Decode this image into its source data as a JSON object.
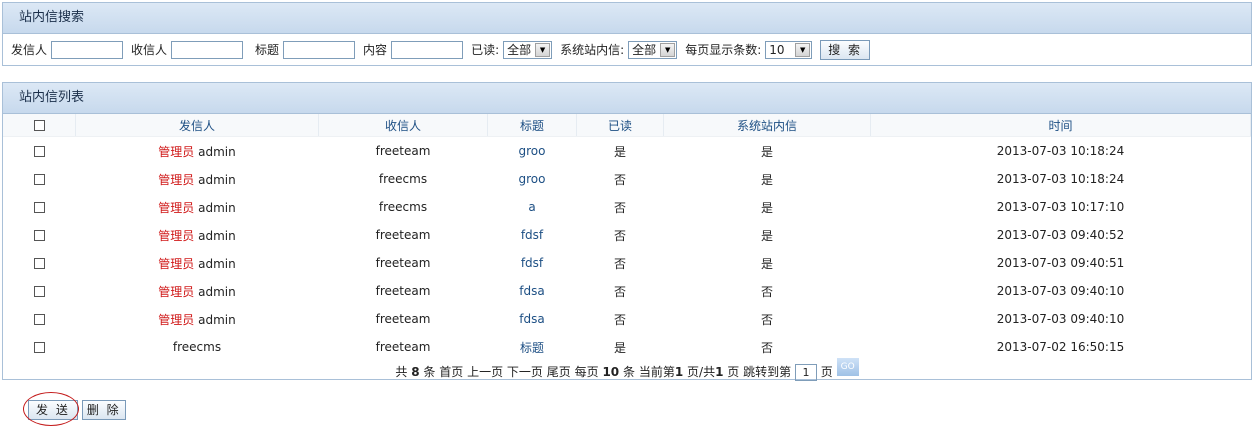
{
  "search": {
    "panel_title": "站内信搜索",
    "sender_label": "发信人",
    "sender_value": "",
    "receiver_label": "收信人",
    "receiver_value": "",
    "title_label": "标题",
    "title_value": "",
    "content_label": "内容",
    "content_value": "",
    "read_label": "已读:",
    "read_selected": "全部",
    "system_label": "系统站内信:",
    "system_selected": "全部",
    "page_size_label": "每页显示条数:",
    "page_size_selected": "10",
    "search_button": "搜 索"
  },
  "list": {
    "panel_title": "站内信列表",
    "columns": [
      "发信人",
      "收信人",
      "标题",
      "已读",
      "系统站内信",
      "时间"
    ],
    "rows": [
      {
        "sender_tag": "管理员",
        "sender": "admin",
        "receiver": "freeteam",
        "title": "groo",
        "read": "是",
        "system": "是",
        "time": "2013-07-03 10:18:24"
      },
      {
        "sender_tag": "管理员",
        "sender": "admin",
        "receiver": "freecms",
        "title": "groo",
        "read": "否",
        "system": "是",
        "time": "2013-07-03 10:18:24"
      },
      {
        "sender_tag": "管理员",
        "sender": "admin",
        "receiver": "freecms",
        "title": "a",
        "read": "否",
        "system": "是",
        "time": "2013-07-03 10:17:10"
      },
      {
        "sender_tag": "管理员",
        "sender": "admin",
        "receiver": "freeteam",
        "title": "fdsf",
        "read": "否",
        "system": "是",
        "time": "2013-07-03 09:40:52"
      },
      {
        "sender_tag": "管理员",
        "sender": "admin",
        "receiver": "freeteam",
        "title": "fdsf",
        "read": "否",
        "system": "是",
        "time": "2013-07-03 09:40:51"
      },
      {
        "sender_tag": "管理员",
        "sender": "admin",
        "receiver": "freeteam",
        "title": "fdsa",
        "read": "否",
        "system": "否",
        "time": "2013-07-03 09:40:10"
      },
      {
        "sender_tag": "管理员",
        "sender": "admin",
        "receiver": "freeteam",
        "title": "fdsa",
        "read": "否",
        "system": "否",
        "time": "2013-07-03 09:40:10"
      },
      {
        "sender_tag": "",
        "sender": "freecms",
        "receiver": "freeteam",
        "title": "标题",
        "read": "是",
        "system": "否",
        "time": "2013-07-02 16:50:15"
      }
    ]
  },
  "pager": {
    "total_prefix": "共",
    "total": "8",
    "total_suffix": "条",
    "first": "首页",
    "prev": "上一页",
    "next": "下一页",
    "last": "尾页",
    "per_page_prefix": "每页",
    "per_page": "10",
    "per_page_suffix": "条",
    "current_prefix": "当前第",
    "current": "1",
    "pages_mid": "页/共",
    "pages": "1",
    "pages_suffix": "页",
    "jump_label": "跳转到第",
    "jump_value": "1",
    "jump_suffix": "页",
    "go": "GO"
  },
  "actions": {
    "send": "发 送",
    "delete": "删 除"
  },
  "colors": {
    "accent_red": "#d01818",
    "header_text": "#1d4f84",
    "panel_border": "#a9c0d8"
  }
}
